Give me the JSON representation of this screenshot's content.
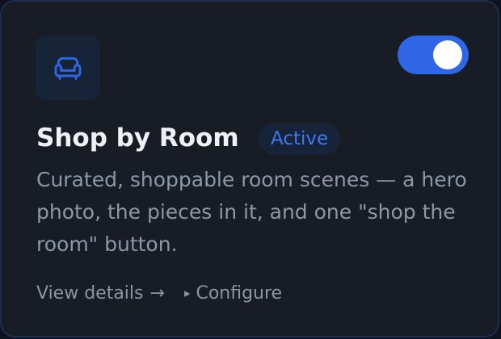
{
  "card": {
    "icon": "sofa-icon",
    "toggle_state": "on",
    "title": "Shop by Room",
    "badge": "Active",
    "description": "Curated, shoppable room scenes — a hero photo, the pieces in it, and one \"shop the room\" button.",
    "links": {
      "view_details": "View details",
      "view_details_arrow": "→",
      "configure_marker": "▸",
      "configure": "Configure"
    }
  },
  "colors": {
    "card_background": "#181d25",
    "card_border": "#1d2d4d",
    "accent": "#2f66e6",
    "badge_text": "#3f78ee",
    "title_text": "#eef1f6",
    "muted_text": "#8d97a6"
  }
}
